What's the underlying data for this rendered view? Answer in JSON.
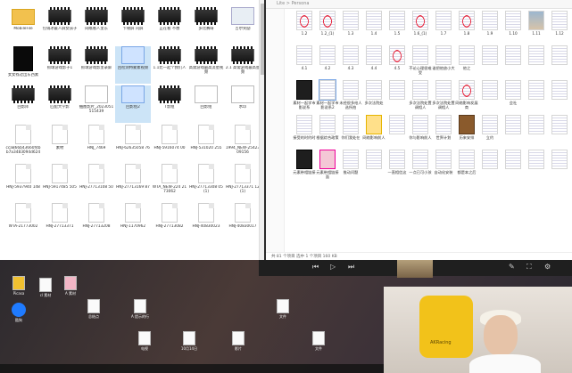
{
  "left_window": {
    "items": [
      {
        "label": "MobileFile",
        "kind": "folder"
      },
      {
        "label": "包销冰最人屏女孩子",
        "kind": "video"
      },
      {
        "label": "同瞧看人里东",
        "kind": "video"
      },
      {
        "label": "卡顿屏 闪屏",
        "kind": "video"
      },
      {
        "label": "正在看 不想",
        "kind": "video"
      },
      {
        "label": "多比赛呀",
        "kind": "video"
      },
      {
        "label": "吉尔奖励",
        "kind": "light"
      },
      {
        "label": "女女找过出东西素",
        "kind": "dark"
      },
      {
        "label": "抓球游戏影子1",
        "kind": "video"
      },
      {
        "label": "抓球游戏影里录屏",
        "kind": "video"
      },
      {
        "label": "回检测特蒙素视频",
        "kind": "sel"
      },
      {
        "label": "1.1比一起个我们人",
        "kind": "video"
      },
      {
        "label": "高需游戏最高流星视频",
        "kind": "video"
      },
      {
        "label": "2.1 高需游戏最高星频",
        "kind": "video"
      },
      {
        "label": "回影库",
        "kind": "video"
      },
      {
        "label": "匹配大学影",
        "kind": "video"
      },
      {
        "label": "抽图影片_2023051515439",
        "kind": "blank"
      },
      {
        "label": "回影组2",
        "kind": "sel"
      },
      {
        "label": "T影组",
        "kind": "video"
      },
      {
        "label": "回影组",
        "kind": "blank"
      },
      {
        "label": "水印",
        "kind": "blank"
      },
      {
        "label": "cca866b43660f4bb7a3483094d6245",
        "kind": "doc"
      },
      {
        "label": "素材",
        "kind": "doc"
      },
      {
        "label": "HNJ_7469",
        "kind": "doc"
      },
      {
        "label": "HNJ-62635058 76",
        "kind": "doc"
      },
      {
        "label": "HNJ-5916074 00",
        "kind": "doc"
      },
      {
        "label": "HNJ-531020 255",
        "kind": "doc"
      },
      {
        "label": "1994_NEW-2542309156",
        "kind": "doc"
      },
      {
        "label": "HNJ-5937940 148",
        "kind": "doc"
      },
      {
        "label": "HNJ-5917485 505",
        "kind": "doc"
      },
      {
        "label": "HNJ-27713108 50",
        "kind": "doc"
      },
      {
        "label": "HNJ-27713169 87",
        "kind": "doc"
      },
      {
        "label": "WTA_NEW-224 2173062",
        "kind": "doc"
      },
      {
        "label": "HNJ-27713308 05(1)",
        "kind": "doc"
      },
      {
        "label": "HNJ-27713371 12(1)",
        "kind": "doc"
      },
      {
        "label": "WTA-21773002",
        "kind": "doc"
      },
      {
        "label": "HNJ-27713371",
        "kind": "doc"
      },
      {
        "label": "HNJ-27713208",
        "kind": "doc"
      },
      {
        "label": "HNJ-1170962",
        "kind": "doc"
      },
      {
        "label": "HNJ-27713082",
        "kind": "doc"
      },
      {
        "label": "HNJ-40830023",
        "kind": "doc"
      },
      {
        "label": "HNJ-40830017",
        "kind": "doc"
      }
    ]
  },
  "right_window": {
    "path": "Lite > Persona",
    "status": "共 81 个项目   选中 1 个项目   160 KB",
    "items": [
      {
        "label": "1.2",
        "kind": "red"
      },
      {
        "label": "1.2_(1)",
        "kind": "red"
      },
      {
        "label": "1.3",
        "kind": "pg"
      },
      {
        "label": "1.4",
        "kind": "pg"
      },
      {
        "label": "1.5",
        "kind": "pg"
      },
      {
        "label": "1.6_(1)",
        "kind": "red"
      },
      {
        "label": "1.7",
        "kind": "pg"
      },
      {
        "label": "1.8",
        "kind": "red"
      },
      {
        "label": "1.9",
        "kind": "pg"
      },
      {
        "label": "1.10",
        "kind": "pg"
      },
      {
        "label": "1.11",
        "kind": "photo"
      },
      {
        "label": "1.12",
        "kind": "pg"
      },
      {
        "label": "4.1",
        "kind": "pg"
      },
      {
        "label": "4.2",
        "kind": "pg"
      },
      {
        "label": "4.3",
        "kind": "pg"
      },
      {
        "label": "4.4",
        "kind": "pg"
      },
      {
        "label": "4.5",
        "kind": "red"
      },
      {
        "label": "不论心理很难受",
        "kind": "pg"
      },
      {
        "label": "谁把他放小大",
        "kind": "pg"
      },
      {
        "label": "他之",
        "kind": "pg"
      },
      {
        "label": "",
        "kind": "pg"
      },
      {
        "label": "",
        "kind": "pg"
      },
      {
        "label": "",
        "kind": "pg"
      },
      {
        "label": "",
        "kind": "pg"
      },
      {
        "label": "素材一起学市影说系",
        "kind": "dark"
      },
      {
        "label": "素材一起学市影说系2",
        "kind": "sel"
      },
      {
        "label": "未经很多给人选所拍",
        "kind": "pg"
      },
      {
        "label": "多次法院处",
        "kind": "pg"
      },
      {
        "label": "",
        "kind": "pg"
      },
      {
        "label": "多次法院处置调相人",
        "kind": "pg"
      },
      {
        "label": "多次法院处置调相人",
        "kind": "pg"
      },
      {
        "label": "网络影响发展商",
        "kind": "red"
      },
      {
        "label": "",
        "kind": "pg"
      },
      {
        "label": "会社",
        "kind": "pg"
      },
      {
        "label": "",
        "kind": "pg"
      },
      {
        "label": "",
        "kind": "pg"
      },
      {
        "label": "接受的时约时",
        "kind": "pg"
      },
      {
        "label": "根据综合政策",
        "kind": "pg"
      },
      {
        "label": "你们我处在",
        "kind": "pg"
      },
      {
        "label": "网络影响前人",
        "kind": "yellow"
      },
      {
        "label": "",
        "kind": "pg"
      },
      {
        "label": "你与影响前人",
        "kind": "pg"
      },
      {
        "label": "世界计划",
        "kind": "pg"
      },
      {
        "label": "历来安排",
        "kind": "film"
      },
      {
        "label": "立约",
        "kind": "pg"
      },
      {
        "label": "",
        "kind": "pg"
      },
      {
        "label": "",
        "kind": "pg"
      },
      {
        "label": "",
        "kind": "pg"
      },
      {
        "label": "元素带相链接",
        "kind": "dark"
      },
      {
        "label": "元素带相链接面",
        "kind": "pink"
      },
      {
        "label": "推动问题",
        "kind": "pg"
      },
      {
        "label": "",
        "kind": "pg"
      },
      {
        "label": "一直相信这",
        "kind": "pg"
      },
      {
        "label": "一点已可小孩",
        "kind": "pg"
      },
      {
        "label": "自动化安装",
        "kind": "pg"
      },
      {
        "label": "都是本之后",
        "kind": "pg"
      },
      {
        "label": "",
        "kind": "pg"
      },
      {
        "label": "",
        "kind": "pg"
      },
      {
        "label": "",
        "kind": "pg"
      },
      {
        "label": "",
        "kind": "pg"
      }
    ]
  },
  "desktop": {
    "icons": [
      {
        "label": "Picasa",
        "kind": "yellow"
      },
      {
        "label": "酷狗",
        "kind": "blue"
      },
      {
        "label": "cl 素材",
        "kind": "file"
      },
      {
        "label": "A 素材",
        "kind": "pink"
      },
      {
        "label": "总结点",
        "kind": "file"
      },
      {
        "label": "A 提示的行",
        "kind": "file"
      },
      {
        "label": "电视",
        "kind": "file"
      },
      {
        "label": "10月14日",
        "kind": "file"
      },
      {
        "label": "影片",
        "kind": "file"
      },
      {
        "label": "文件",
        "kind": "file"
      },
      {
        "label": "文件",
        "kind": "file"
      }
    ],
    "webcam_chair_text": "AKRacing"
  }
}
